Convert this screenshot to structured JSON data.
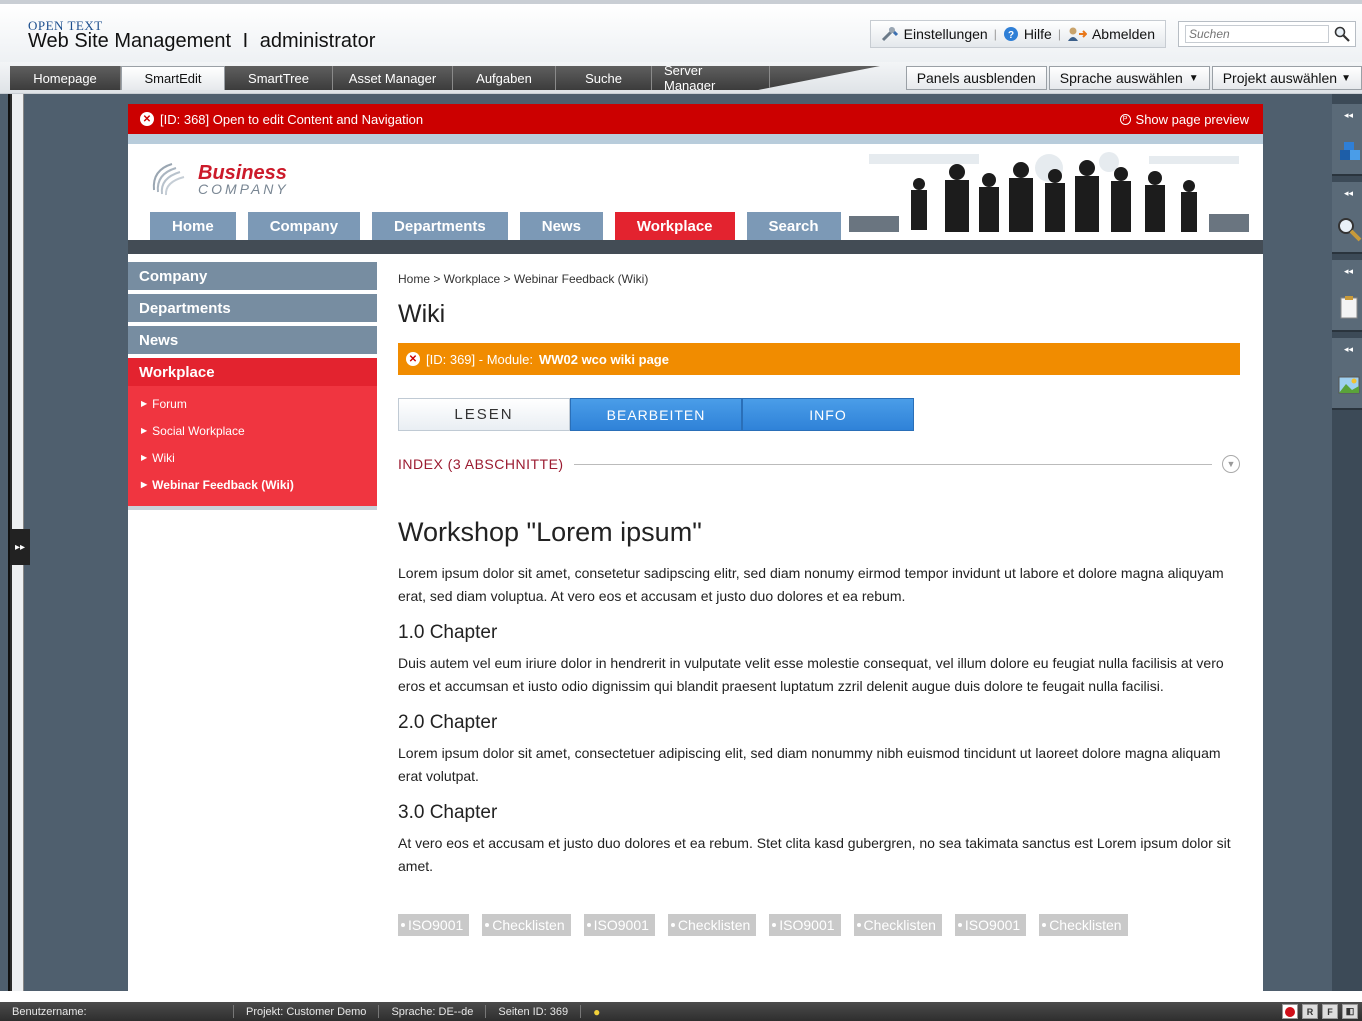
{
  "header": {
    "brand_small": "OPEN TEXT",
    "product_title": "Web Site Management",
    "separator": "I",
    "user": "administrator",
    "settings_label": "Einstellungen",
    "help_label": "Hilfe",
    "logout_label": "Abmelden",
    "search_placeholder": "Suchen"
  },
  "main_tabs": [
    {
      "label": "Homepage"
    },
    {
      "label": "SmartEdit"
    },
    {
      "label": "SmartTree"
    },
    {
      "label": "Asset Manager"
    },
    {
      "label": "Aufgaben"
    },
    {
      "label": "Suche"
    },
    {
      "label": "Server Manager"
    }
  ],
  "right_tabs": {
    "hide_panels": "Panels ausblenden",
    "language": "Sprache auswählen",
    "project": "Projekt auswählen"
  },
  "edit_bar": {
    "label": "[ID: 368] Open to edit Content and Navigation",
    "preview": "Show page preview"
  },
  "site": {
    "logo_word1": "Business",
    "logo_word2": "COMPANY",
    "nav": [
      {
        "label": "Home"
      },
      {
        "label": "Company"
      },
      {
        "label": "Departments"
      },
      {
        "label": "News"
      },
      {
        "label": "Workplace"
      },
      {
        "label": "Search"
      }
    ],
    "left_nav": [
      {
        "label": "Company"
      },
      {
        "label": "Departments"
      },
      {
        "label": "News"
      },
      {
        "label": "Workplace"
      }
    ],
    "subnav": [
      {
        "label": "Forum"
      },
      {
        "label": "Social Workplace"
      },
      {
        "label": "Wiki"
      },
      {
        "label": "Webinar Feedback (Wiki)"
      }
    ]
  },
  "content": {
    "breadcrumb": "Home > Workplace > Webinar Feedback (Wiki)",
    "heading": "Wiki",
    "module_prefix": "[ID: 369] - Module:",
    "module_name": "WW02 wco wiki page",
    "wiki_tabs": [
      {
        "label": "LESEN"
      },
      {
        "label": "BEARBEITEN"
      },
      {
        "label": "INFO"
      }
    ],
    "index_label": "INDEX (3 ABSCHNITTE)",
    "article_title": "Workshop \"Lorem ipsum\"",
    "intro": "Lorem ipsum dolor sit amet, consetetur sadipscing elitr, sed diam nonumy eirmod tempor invidunt ut labore et dolore magna aliquyam erat, sed diam voluptua. At vero eos et accusam et justo duo dolores et ea rebum.",
    "chapters": [
      {
        "title": "1.0 Chapter",
        "text": "Duis autem vel eum iriure dolor in hendrerit in vulputate velit esse molestie consequat, vel illum dolore eu feugiat nulla facilisis at vero eros et accumsan et iusto odio dignissim qui blandit praesent luptatum zzril delenit augue duis dolore te feugait nulla facilisi."
      },
      {
        "title": "2.0 Chapter",
        "text": "Lorem ipsum dolor sit amet, consectetuer adipiscing elit, sed diam nonummy nibh euismod tincidunt ut laoreet dolore magna aliquam erat volutpat."
      },
      {
        "title": "3.0 Chapter",
        "text": "At vero eos et accusam et justo duo dolores et ea rebum. Stet clita kasd gubergren, no sea takimata sanctus est Lorem ipsum dolor sit amet."
      }
    ],
    "tags": [
      "ISO9001",
      "Checklisten",
      "ISO9001",
      "Checklisten",
      "ISO9001",
      "Checklisten",
      "ISO9001",
      "Checklisten"
    ]
  },
  "status_bar": {
    "user_label": "Benutzername:",
    "project": "Projekt: Customer Demo",
    "language": "Sprache: DE--de",
    "page_id": "Seiten ID: 369"
  },
  "colors": {
    "accent_red": "#e3232f",
    "edit_bar_red": "#cc0000",
    "module_orange": "#f18c00",
    "nav_blue": "#7c99b6",
    "tab_blue": "#2f82d8"
  }
}
